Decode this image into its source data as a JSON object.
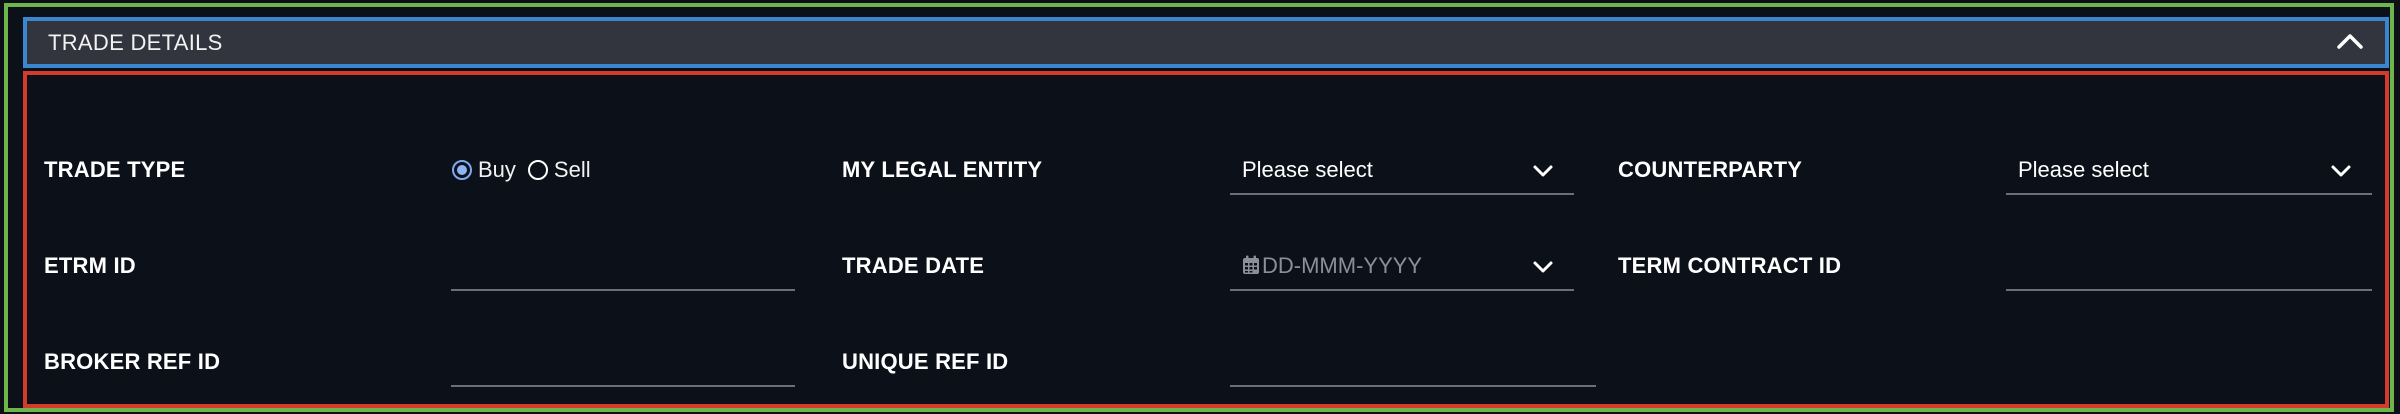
{
  "panel": {
    "title": "TRADE DETAILS"
  },
  "fields": {
    "trade_type": {
      "label": "TRADE TYPE",
      "options": [
        "Buy",
        "Sell"
      ],
      "selected": "Buy"
    },
    "my_legal_entity": {
      "label": "MY LEGAL ENTITY",
      "value": "Please select"
    },
    "counterparty": {
      "label": "COUNTERPARTY",
      "value": "Please select"
    },
    "etrm_id": {
      "label": "ETRM ID",
      "value": ""
    },
    "trade_date": {
      "label": "TRADE DATE",
      "placeholder": "DD-MMM-YYYY"
    },
    "term_contract_id": {
      "label": "TERM CONTRACT ID",
      "value": ""
    },
    "broker_ref_id": {
      "label": "BROKER REF ID",
      "value": ""
    },
    "unique_ref_id": {
      "label": "UNIQUE REF ID",
      "value": ""
    }
  },
  "icons": {
    "collapse": "chevron-up-icon",
    "dropdown": "chevron-down-icon",
    "calendar": "calendar-icon"
  },
  "colors": {
    "background": "#0c1119",
    "header_bg": "#32343e",
    "radio_accent": "#8fb3f5"
  }
}
